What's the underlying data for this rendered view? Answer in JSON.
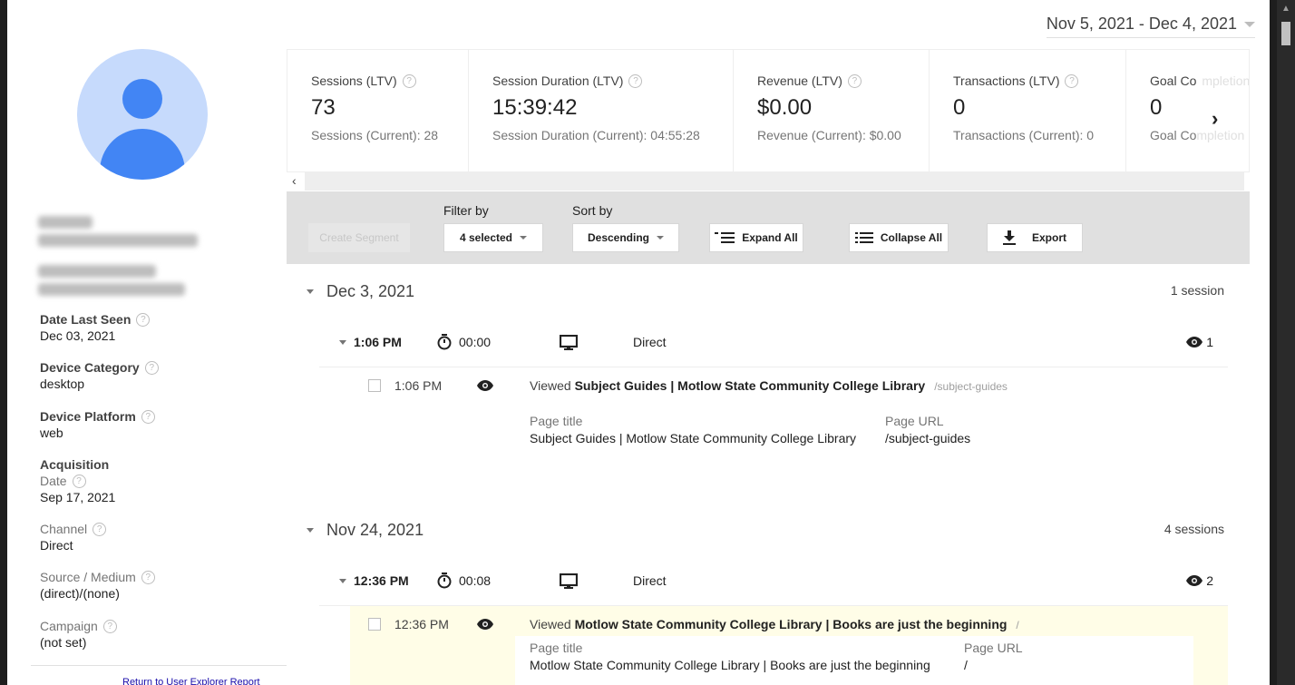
{
  "header": {
    "date_range": "Nov 5, 2021 - Dec 4, 2021"
  },
  "sidebar": {
    "date_last_seen": {
      "label": "Date Last Seen",
      "value": "Dec 03, 2021"
    },
    "device_category": {
      "label": "Device Category",
      "value": "desktop"
    },
    "device_platform": {
      "label": "Device Platform",
      "value": "web"
    },
    "acquisition": {
      "label": "Acquisition",
      "date": {
        "label": "Date",
        "value": "Sep 17, 2021"
      },
      "channel": {
        "label": "Channel",
        "value": "Direct"
      },
      "source_medium": {
        "label": "Source / Medium",
        "value": "(direct)/(none)"
      },
      "campaign": {
        "label": "Campaign",
        "value": "(not set)"
      }
    },
    "return_link": "Return to User Explorer Report"
  },
  "metrics": [
    {
      "title": "Sessions (LTV)",
      "value": "73",
      "current": "Sessions (Current): 28"
    },
    {
      "title": "Session Duration (LTV)",
      "value": "15:39:42",
      "current": "Session Duration (Current): 04:55:28"
    },
    {
      "title": "Revenue (LTV)",
      "value": "$0.00",
      "current": "Revenue (Current): $0.00"
    },
    {
      "title": "Transactions (LTV)",
      "value": "0",
      "current": "Transactions (Current): 0"
    },
    {
      "title_a": "Goal Co",
      "title_b": "mpletion",
      "value": "0",
      "current_a": "Goal Co",
      "current_b": "mpletion"
    }
  ],
  "toolbar": {
    "create_segment": "Create Segment",
    "filter_label": "Filter by",
    "filter_value": "4 selected",
    "sort_label": "Sort by",
    "sort_value": "Descending",
    "expand_all": "Expand All",
    "collapse_all": "Collapse All",
    "export": "Export"
  },
  "timeline": [
    {
      "date": "Dec 3, 2021",
      "count": "1 session",
      "session": {
        "time": "1:06 PM",
        "duration": "00:00",
        "channel": "Direct",
        "views": "1",
        "hit": {
          "time": "1:06 PM",
          "action": "Viewed",
          "title": "Subject Guides | Motlow State Community College Library",
          "path": "/subject-guides",
          "page_title_label": "Page title",
          "page_title": "Subject Guides | Motlow State Community College Library",
          "page_url_label": "Page URL",
          "page_url": "/subject-guides"
        }
      }
    },
    {
      "date": "Nov 24, 2021",
      "count": "4 sessions",
      "session": {
        "time": "12:36 PM",
        "duration": "00:08",
        "channel": "Direct",
        "views": "2",
        "hit": {
          "time": "12:36 PM",
          "action": "Viewed",
          "title": "Motlow State Community College Library | Books are just the beginning",
          "path": "/",
          "page_title_label": "Page title",
          "page_title": "Motlow State Community College Library | Books are just the beginning",
          "page_url_label": "Page URL",
          "page_url": "/"
        }
      }
    }
  ]
}
